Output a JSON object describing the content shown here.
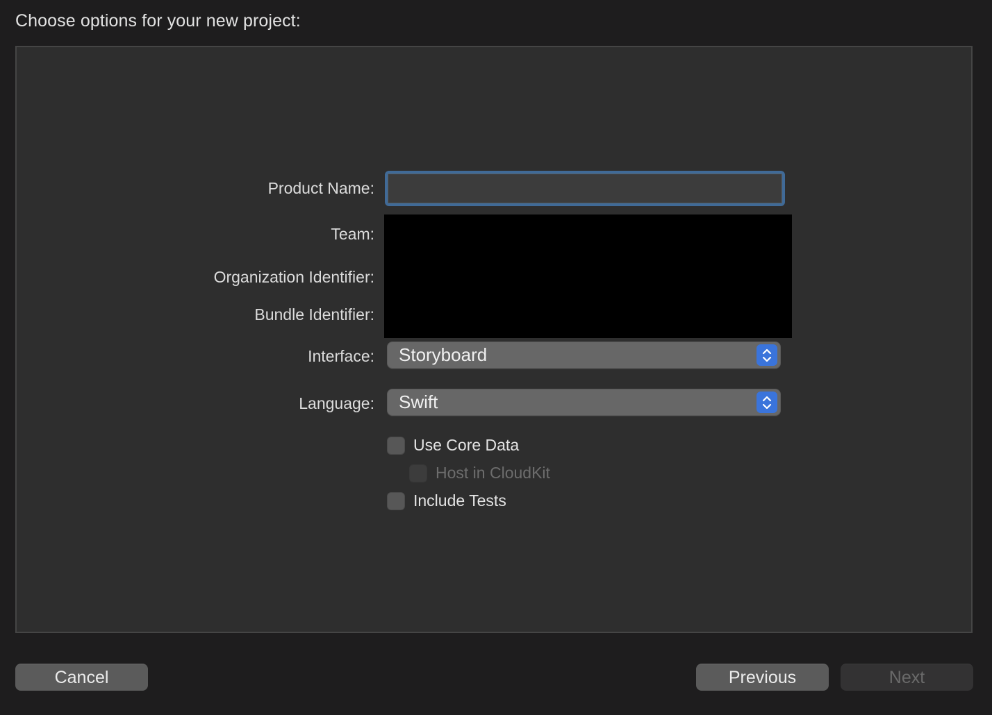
{
  "header": {
    "title": "Choose options for your new project:"
  },
  "form": {
    "product_name": {
      "label": "Product Name:",
      "value": ""
    },
    "team": {
      "label": "Team:"
    },
    "organization_identifier": {
      "label": "Organization Identifier:"
    },
    "bundle_identifier": {
      "label": "Bundle Identifier:"
    },
    "interface": {
      "label": "Interface:",
      "selected": "Storyboard"
    },
    "language": {
      "label": "Language:",
      "selected": "Swift"
    },
    "checkboxes": [
      {
        "label": "Use Core Data",
        "checked": false,
        "enabled": true
      },
      {
        "label": "Host in CloudKit",
        "checked": false,
        "enabled": false
      },
      {
        "label": "Include Tests",
        "checked": false,
        "enabled": true
      }
    ]
  },
  "footer": {
    "cancel_label": "Cancel",
    "previous_label": "Previous",
    "next_label": "Next"
  },
  "colors": {
    "focus_ring": "#406a97",
    "stepper_accent": "#3a74db"
  }
}
